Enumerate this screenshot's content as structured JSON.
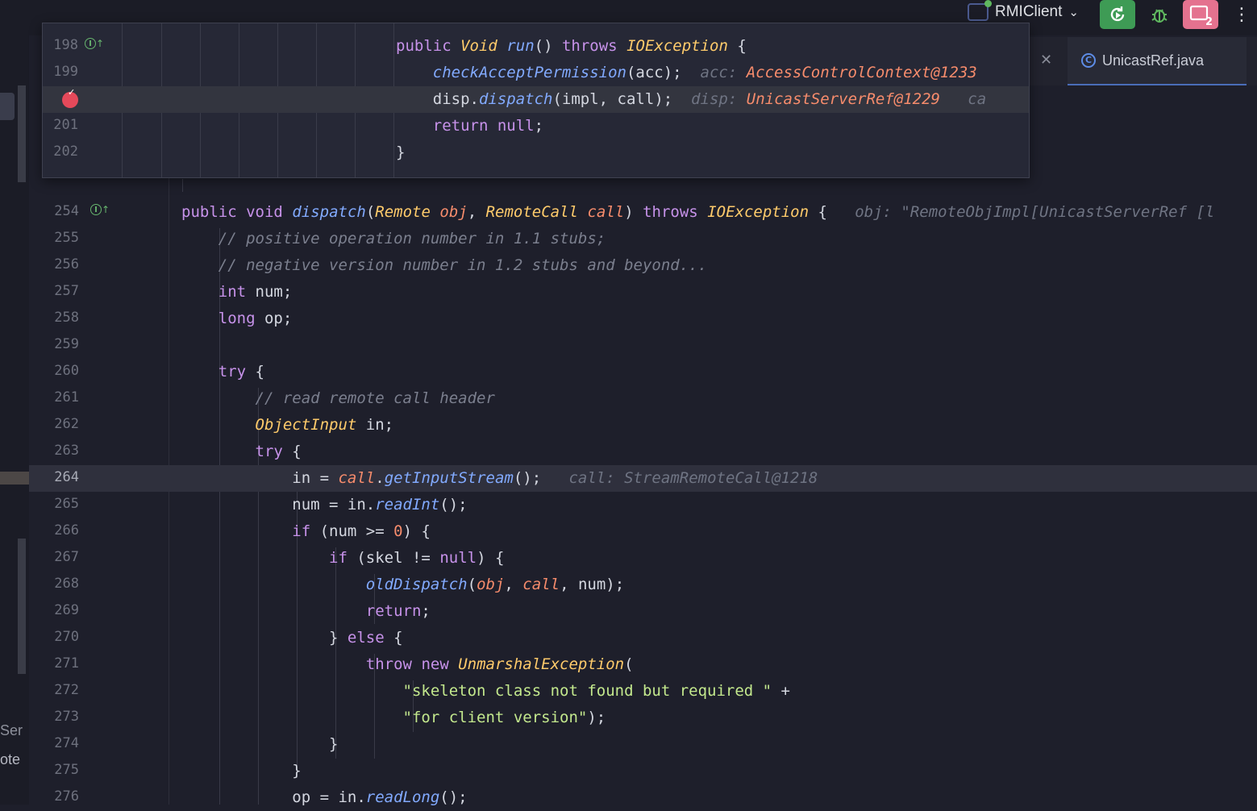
{
  "toolbar": {
    "run_config": "RMIClient",
    "colors": {
      "rerun": "#3e9b55",
      "reconnect": "#e4728f",
      "debug": "#5fb85f"
    }
  },
  "editor_tab": {
    "label": "UnicastRef.java"
  },
  "left_panel": {
    "frag1": "Ser",
    "frag2": "ote"
  },
  "peek": {
    "lines": [
      {
        "num": "198",
        "gutter": "implements-icon",
        "text": "public Void run() throws IOException {"
      },
      {
        "num": "199",
        "text": "checkAcceptPermission(acc);",
        "hint_label": "acc:",
        "hint_value": "AccessControlContext@1233"
      },
      {
        "num": "",
        "gutter": "breakpoint-icon",
        "text": "disp.dispatch(impl, call);",
        "hint_label": "disp:",
        "hint_value": "UnicastServerRef@1229",
        "hint_tail": "ca"
      },
      {
        "num": "201",
        "text": "return null;"
      },
      {
        "num": "202",
        "text": "}"
      }
    ]
  },
  "code": {
    "lines": [
      {
        "num": "254",
        "text": "public void dispatch(Remote obj, RemoteCall call) throws IOException {",
        "hint": "obj: \"RemoteObjImpl[UnicastServerRef [l"
      },
      {
        "num": "255",
        "text": "// positive operation number in 1.1 stubs;"
      },
      {
        "num": "256",
        "text": "// negative version number in 1.2 stubs and beyond..."
      },
      {
        "num": "257",
        "text": "int num;"
      },
      {
        "num": "258",
        "text": "long op;"
      },
      {
        "num": "259",
        "text": ""
      },
      {
        "num": "260",
        "text": "try {"
      },
      {
        "num": "261",
        "text": "// read remote call header"
      },
      {
        "num": "262",
        "text": "ObjectInput in;"
      },
      {
        "num": "263",
        "text": "try {"
      },
      {
        "num": "264",
        "text": "in = call.getInputStream();",
        "hint": "call: StreamRemoteCall@1218"
      },
      {
        "num": "265",
        "text": "num = in.readInt();"
      },
      {
        "num": "266",
        "text": "if (num >= 0) {"
      },
      {
        "num": "267",
        "text": "if (skel != null) {"
      },
      {
        "num": "268",
        "text": "oldDispatch(obj, call, num);"
      },
      {
        "num": "269",
        "text": "return;"
      },
      {
        "num": "270",
        "text": "} else {"
      },
      {
        "num": "271",
        "text": "throw new UnmarshalException("
      },
      {
        "num": "272",
        "text": "\"skeleton class not found but required \" +"
      },
      {
        "num": "273",
        "text": "\"for client version\");"
      },
      {
        "num": "274",
        "text": "}"
      },
      {
        "num": "275",
        "text": "}"
      },
      {
        "num": "276",
        "text": "op = in.readLong();"
      }
    ]
  }
}
